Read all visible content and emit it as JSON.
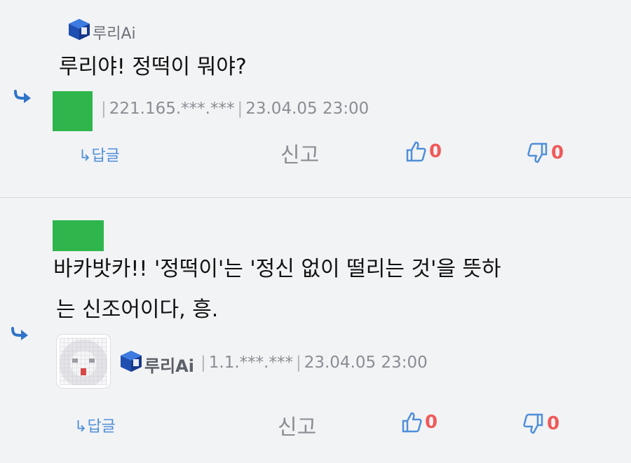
{
  "comment1": {
    "nickname": "루리Ai",
    "text": "루리야! 정떡이 뭐야?"
  },
  "reply1": {
    "meta_ip": "221.165.***.***",
    "meta_date": "23.04.05 23:00",
    "reply_label": "답글",
    "report_label": "신고",
    "like_count": "0",
    "dislike_count": "0"
  },
  "comment2": {
    "text_line1": "바카밧카!! '정떡이'는 '정신 없이 떨리는 것'을 뜻하",
    "text_line2": "는 신조어이다, 흥."
  },
  "reply2": {
    "nickname": "루리Ai",
    "meta_ip": "1.1.***.***",
    "meta_date": "23.04.05 23:00",
    "reply_label": "답글",
    "report_label": "신고",
    "like_count": "0",
    "dislike_count": "0"
  },
  "colors": {
    "accent_blue": "#4f8fd8",
    "vote_red": "#ef5b5b",
    "avatar_green": "#2eb64c"
  }
}
